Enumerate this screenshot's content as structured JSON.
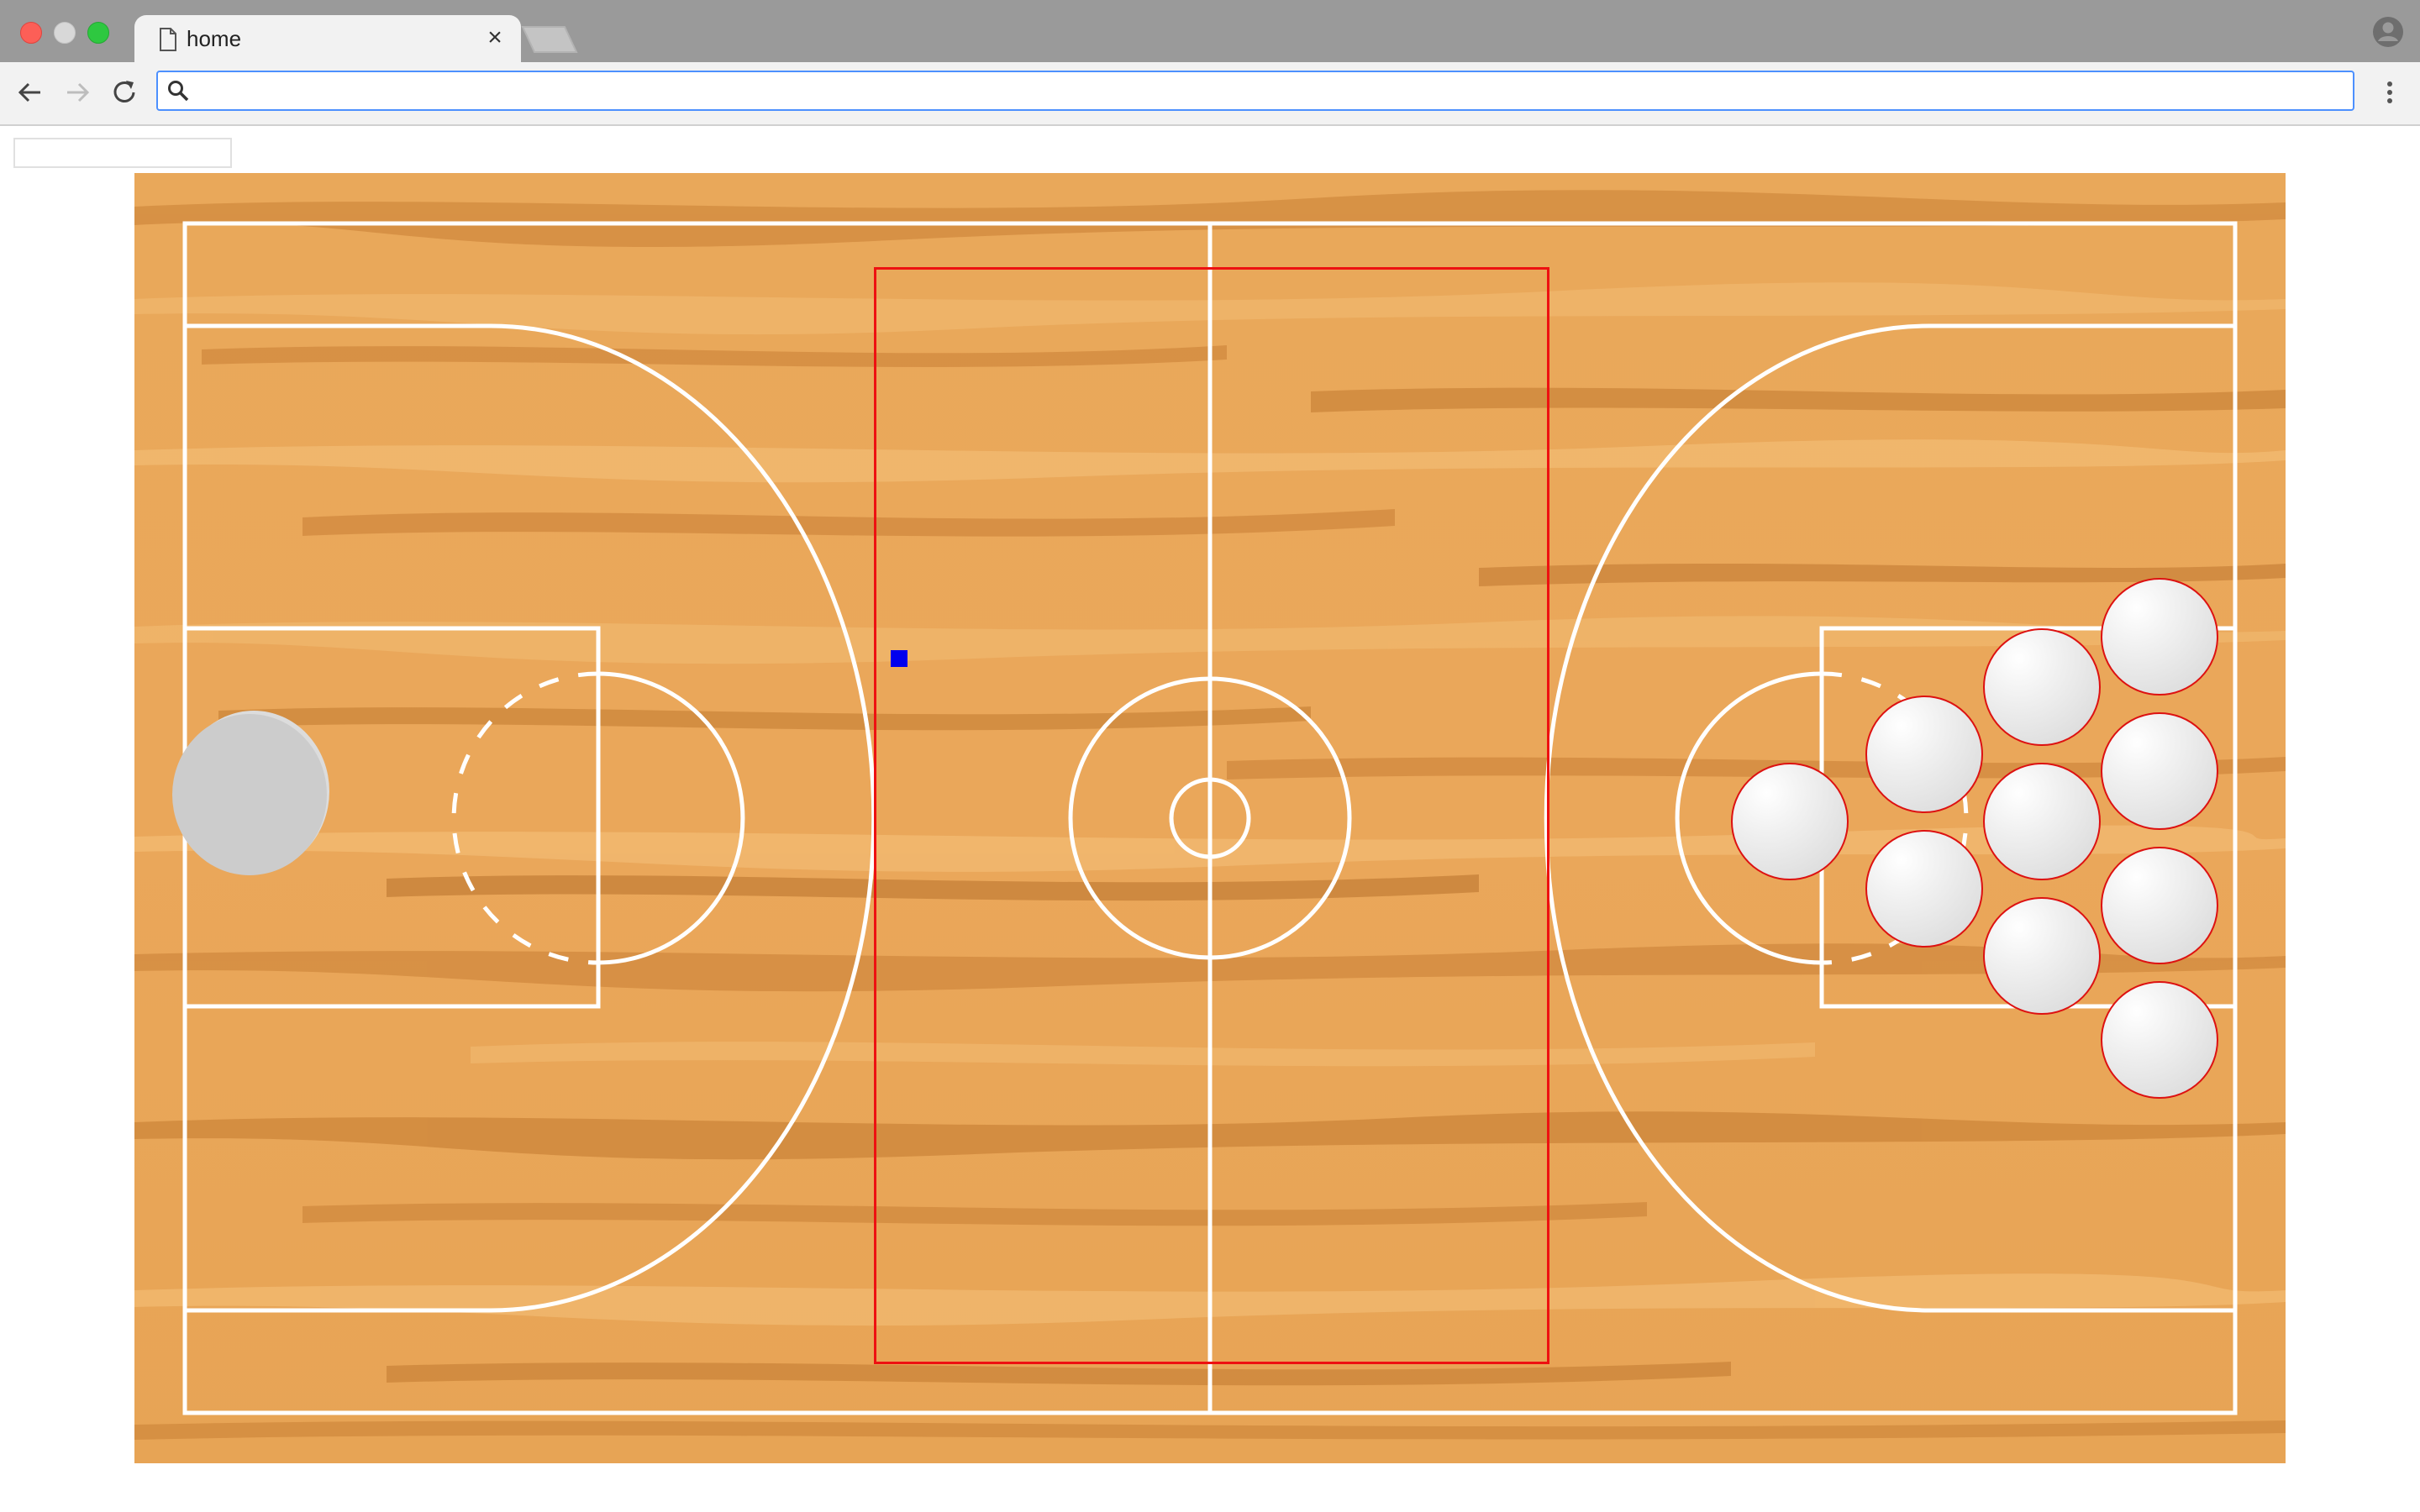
{
  "browser": {
    "tab_title": "home",
    "tab_close_symbol": "×",
    "address_value": "",
    "address_placeholder": ""
  },
  "page": {
    "text_input_value": ""
  },
  "game": {
    "court_type": "basketball-court",
    "colors": {
      "wood_base": "#e8a558",
      "wood_dark": "#c97f35",
      "wood_light": "#f3bd75",
      "court_lines": "#ffffff",
      "drop_zone_border": "#ee1111",
      "marker": "#0000ee",
      "ball_fill": "#eeeeee",
      "ball_border": "#dd1111",
      "held_ball": "#cccccc"
    },
    "balls_in_rack": 10,
    "balls_held": 1
  },
  "icons": {
    "tab": "document-icon",
    "new_tab": "new-tab-icon",
    "profile": "profile-icon",
    "back": "back-arrow-icon",
    "forward": "forward-arrow-icon",
    "reload": "reload-icon",
    "search": "search-icon",
    "menu": "kebab-menu-icon"
  }
}
